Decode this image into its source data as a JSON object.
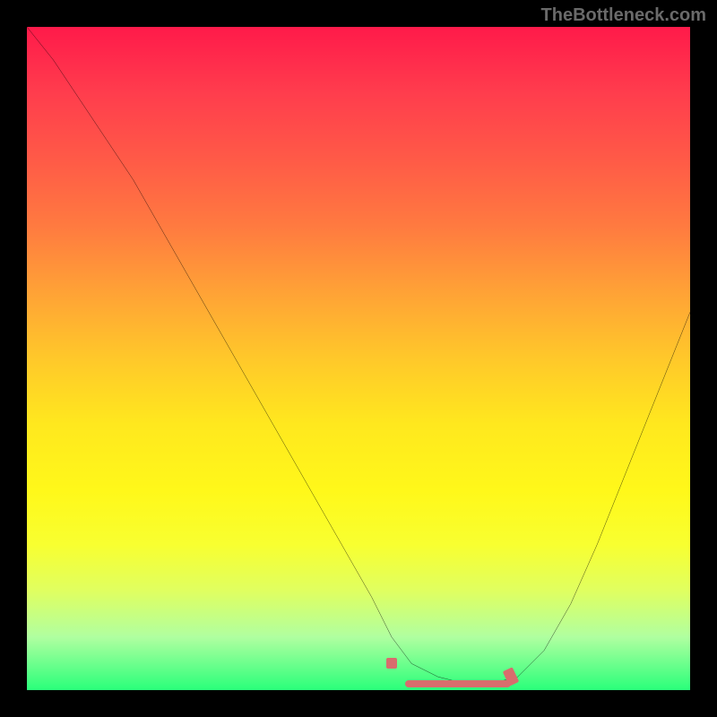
{
  "watermark": "TheBottleneck.com",
  "colors": {
    "background": "#000000",
    "gradient_top": "#ff1a4a",
    "gradient_bottom": "#2aff7a",
    "curve": "#000000",
    "marker": "#d86d6d"
  },
  "chart_data": {
    "type": "line",
    "title": "",
    "xlabel": "",
    "ylabel": "",
    "xlim": [
      0,
      100
    ],
    "ylim": [
      0,
      100
    ],
    "grid": false,
    "legend": false,
    "series": [
      {
        "name": "curve",
        "x": [
          0,
          4,
          8,
          12,
          16,
          20,
          24,
          28,
          32,
          36,
          40,
          44,
          48,
          52,
          55,
          58,
          62,
          66,
          70,
          74,
          78,
          82,
          86,
          90,
          94,
          98,
          100
        ],
        "y": [
          100,
          95,
          89,
          83,
          77,
          70,
          63,
          56,
          49,
          42,
          35,
          28,
          21,
          14,
          8,
          4,
          2,
          1,
          1,
          2,
          6,
          13,
          22,
          32,
          42,
          52,
          57
        ]
      }
    ],
    "markers": [
      {
        "name": "marker-left",
        "x": 55,
        "y": 4
      },
      {
        "name": "marker-right",
        "x": 73,
        "y": 2
      }
    ],
    "flat_region": {
      "x_start": 57,
      "x_end": 73,
      "y": 1
    }
  }
}
